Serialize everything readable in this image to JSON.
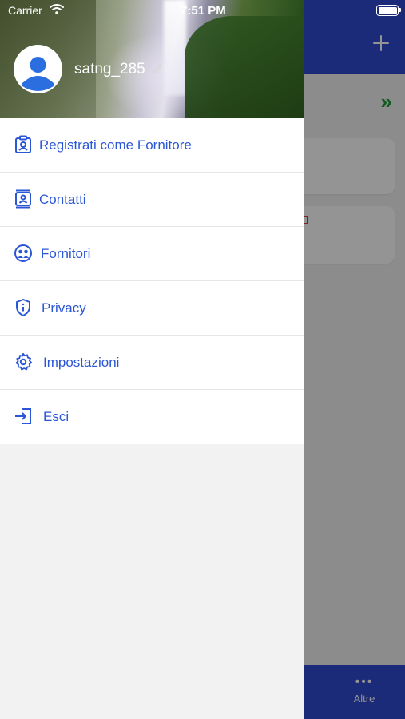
{
  "status_bar": {
    "carrier": "Carrier",
    "time": "7:51 PM"
  },
  "drawer": {
    "username": "satng_285",
    "menu": [
      {
        "label": "Registrati come Fornitore",
        "icon": "badge-icon"
      },
      {
        "label": "Contatti",
        "icon": "contacts-icon"
      },
      {
        "label": "Fornitori",
        "icon": "suppliers-icon"
      },
      {
        "label": "Privacy",
        "icon": "shield-info-icon"
      },
      {
        "label": "Impostazioni",
        "icon": "gear-icon"
      },
      {
        "label": "Esci",
        "icon": "logout-icon"
      }
    ]
  },
  "background": {
    "tab_more_label": "Altre"
  },
  "colors": {
    "accent": "#2b57d6",
    "brand_bar": "#2f49d1",
    "chevron_green": "#1e9b3a"
  }
}
